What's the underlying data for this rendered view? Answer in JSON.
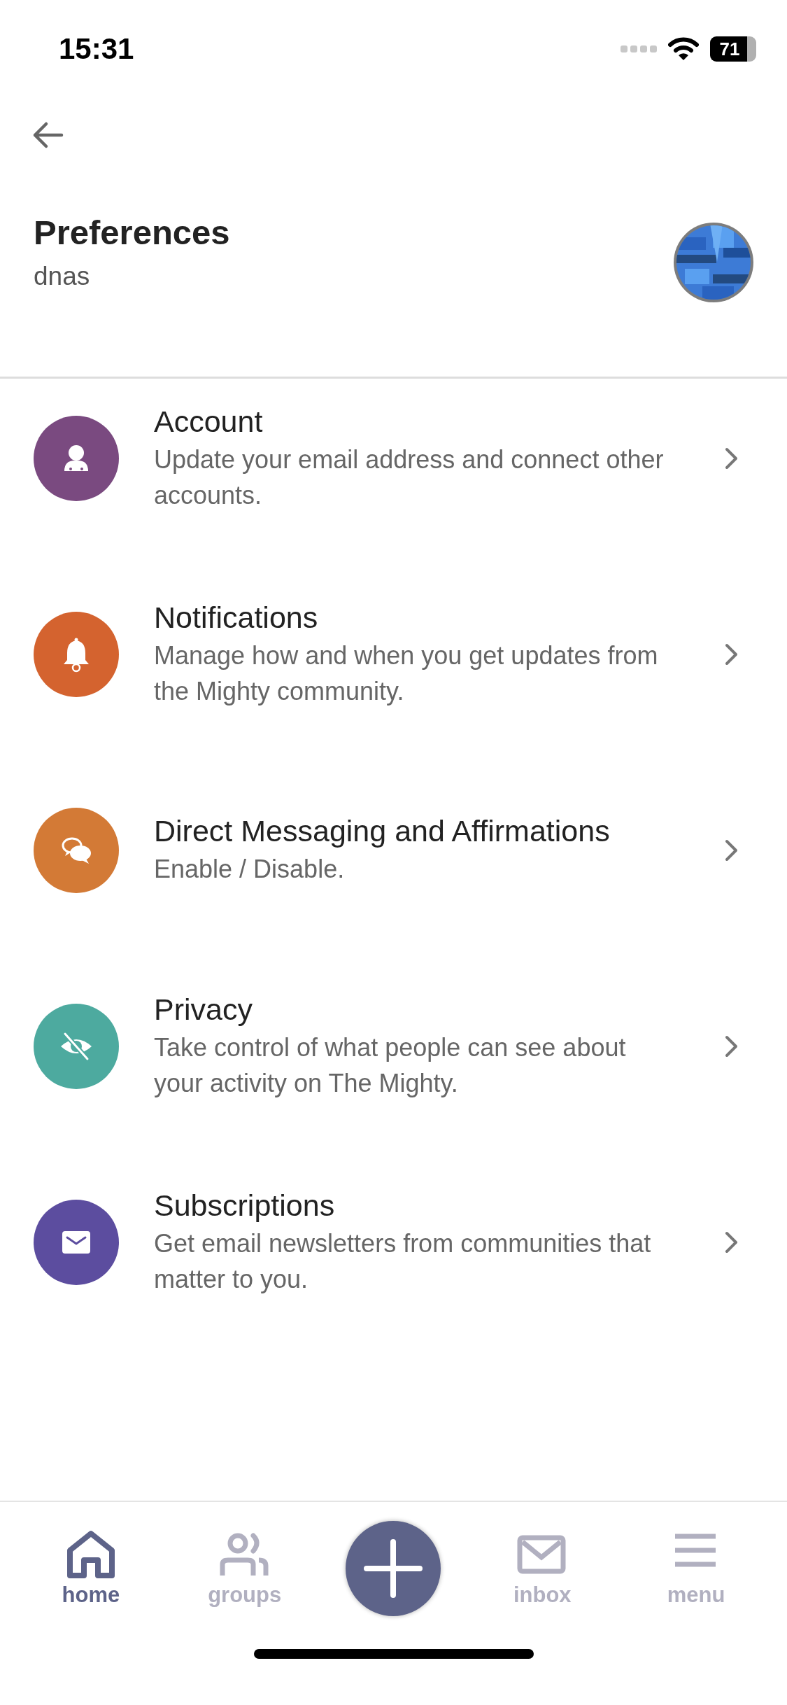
{
  "status_bar": {
    "time": "15:31",
    "battery": "71"
  },
  "header": {
    "title": "Preferences",
    "username": "dnas"
  },
  "items": [
    {
      "kind": "account",
      "color": "#7a4a80",
      "title": "Account",
      "description": "Update your email address and connect other accounts."
    },
    {
      "kind": "notifications",
      "color": "#d4632f",
      "title": "Notifications",
      "description": "Manage how and when you get updates from the Mighty community."
    },
    {
      "kind": "messaging",
      "color": "#d37a36",
      "title": "Direct Messaging and Affirmations",
      "description": "Enable / Disable."
    },
    {
      "kind": "privacy",
      "color": "#4daa9f",
      "title": "Privacy",
      "description": "Take control of what people can see about your activity on The Mighty."
    },
    {
      "kind": "subscriptions",
      "color": "#5c4d9f",
      "title": "Subscriptions",
      "description": "Get email newsletters from communities that matter to you."
    }
  ],
  "tab_bar": [
    {
      "kind": "home",
      "label": "home",
      "selected": true
    },
    {
      "kind": "groups",
      "label": "groups",
      "selected": false
    },
    {
      "kind": "add",
      "selected": false
    },
    {
      "kind": "inbox",
      "label": "inbox",
      "selected": false
    },
    {
      "kind": "menu",
      "label": "menu",
      "selected": false
    }
  ]
}
